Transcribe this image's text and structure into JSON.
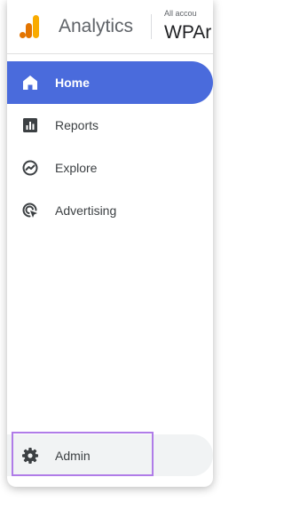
{
  "header": {
    "app_title": "Analytics",
    "account_label": "All accou",
    "account_name": "WPAr",
    "logo_icon": "google-analytics-logo",
    "logo_colors": [
      "#F9AB00",
      "#E37400"
    ]
  },
  "nav": {
    "items": [
      {
        "label": "Home",
        "icon": "home-icon",
        "active": true
      },
      {
        "label": "Reports",
        "icon": "bar-chart-icon",
        "active": false
      },
      {
        "label": "Explore",
        "icon": "explore-icon",
        "active": false
      },
      {
        "label": "Advertising",
        "icon": "advertising-icon",
        "active": false
      }
    ]
  },
  "admin": {
    "label": "Admin",
    "icon": "gear-icon",
    "highlight_color": "#B07CE8"
  },
  "colors": {
    "active_bg": "#4A6BDC",
    "text": "#3C4043"
  }
}
